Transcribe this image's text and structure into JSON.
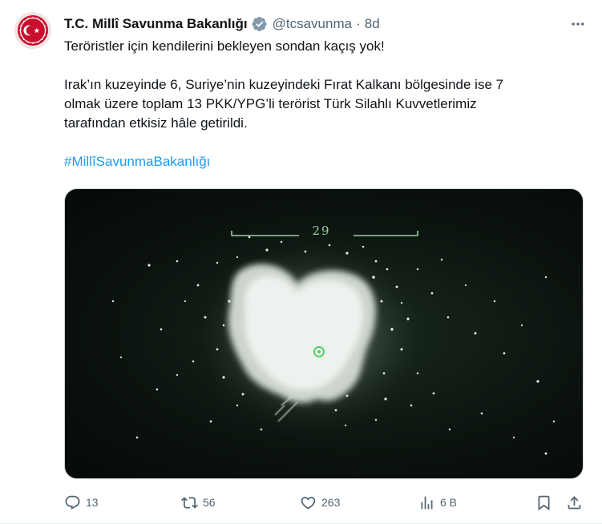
{
  "tweet": {
    "display_name": "T.C. Millî Savunma Bakanlığı",
    "handle": "@tcsavunma",
    "separator": "·",
    "time": "8d",
    "line1": "Teröristler için kendilerini bekleyen sondan kaçış yok!",
    "line2": "Irak’ın kuzeyinde 6, Suriye’nin kuzeyindeki Fırat Kalkanı bölgesinde ise 7",
    "line3": "olmak üzere toplam 13 PKK/YPG’li terörist Türk Silahlı Kuvvetlerimiz",
    "line4": "tarafından etkisiz hâle getirildi.",
    "hashtag": "#MillîSavunmaBakanlığı"
  },
  "media": {
    "hud_number": "29"
  },
  "actions": {
    "replies": "13",
    "reposts": "56",
    "likes": "263",
    "views": "6 B"
  },
  "icons": {
    "avatar": "ministry-emblem-icon",
    "verified": "verified-badge-icon",
    "more": "more-icon",
    "reply": "reply-icon",
    "repost": "repost-icon",
    "like": "like-icon",
    "views": "views-icon",
    "bookmark": "bookmark-icon",
    "share": "share-icon"
  },
  "colors": {
    "text": "#0f1419",
    "secondary": "#536471",
    "link": "#1d9bf0",
    "verified": "#829aab",
    "avatar_red": "#c8102e"
  }
}
